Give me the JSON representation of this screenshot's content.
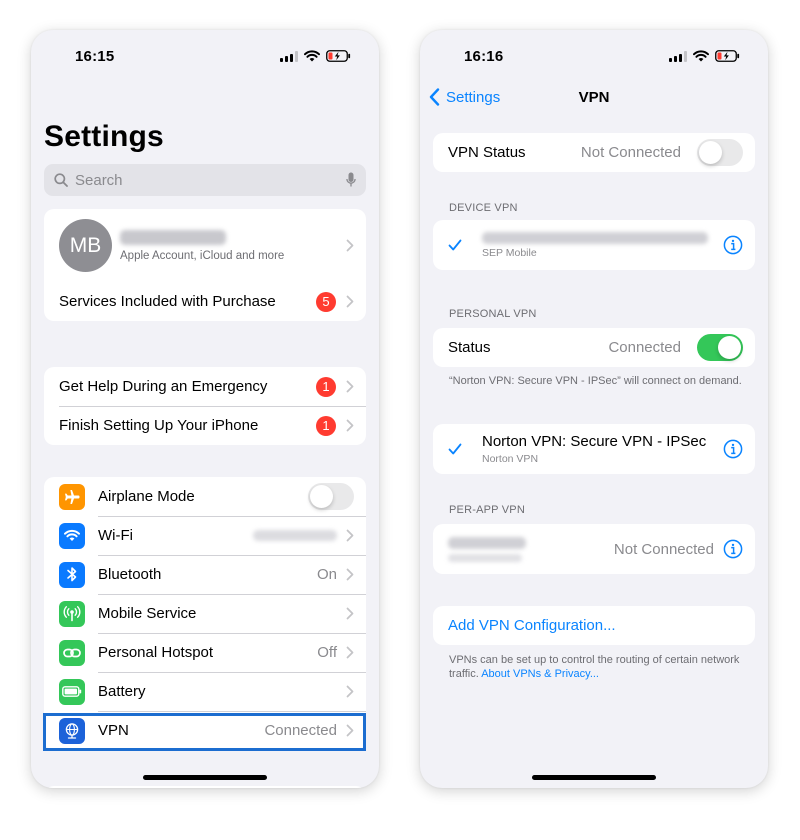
{
  "colors": {
    "accent_blue": "#0a84ff",
    "toggle_on": "#34c759",
    "badge_red": "#ff3b30",
    "highlight": "#1c6dd0",
    "background": "#f2f2f7"
  },
  "left_screen": {
    "status_time": "16:15",
    "title": "Settings",
    "search": {
      "placeholder": "Search",
      "icon": "magnifier-icon",
      "mic_icon": "microphone-icon"
    },
    "profile": {
      "initials": "MB",
      "subtitle": "Apple Account, iCloud and more"
    },
    "services": {
      "label": "Services Included with Purchase",
      "badge": "5"
    },
    "help_group": [
      {
        "label": "Get Help During an Emergency",
        "badge": "1"
      },
      {
        "label": "Finish Setting Up Your iPhone",
        "badge": "1"
      }
    ],
    "settings_group": [
      {
        "label": "Airplane Mode",
        "icon": "airplane-icon",
        "icon_bg": "#ff9500",
        "toggle": "off"
      },
      {
        "label": "Wi-Fi",
        "icon": "wifi-icon",
        "icon_bg": "#0a7aff"
      },
      {
        "label": "Bluetooth",
        "value": "On",
        "icon": "bluetooth-icon",
        "icon_bg": "#0a7aff"
      },
      {
        "label": "Mobile Service",
        "icon": "antenna-icon",
        "icon_bg": "#34c759"
      },
      {
        "label": "Personal Hotspot",
        "value": "Off",
        "icon": "hotspot-chain-icon",
        "icon_bg": "#34c759"
      },
      {
        "label": "Battery",
        "icon": "battery-icon",
        "icon_bg": "#34c759"
      },
      {
        "label": "VPN",
        "value": "Connected",
        "icon": "vpn-globe-icon",
        "icon_bg": "#1c62d9",
        "highlighted": true
      }
    ]
  },
  "right_screen": {
    "status_time": "16:16",
    "nav": {
      "back_label": "Settings",
      "title": "VPN"
    },
    "vpn_status": {
      "label": "VPN Status",
      "value": "Not Connected",
      "toggle": "off"
    },
    "device_vpn": {
      "header": "DEVICE VPN",
      "subtitle": "SEP Mobile"
    },
    "personal_vpn": {
      "header": "PERSONAL VPN",
      "status_label": "Status",
      "status_value": "Connected",
      "toggle": "on",
      "footer": "“Norton VPN: Secure VPN - IPSec” will connect on demand.",
      "config_name": "Norton VPN: Secure VPN - IPSec",
      "config_sub": "Norton VPN"
    },
    "per_app_vpn": {
      "header": "PER-APP VPN",
      "value": "Not Connected"
    },
    "add_config": "Add VPN Configuration...",
    "footer_text": "VPNs can be set up to control the routing of certain network traffic. ",
    "footer_link": "About VPNs & Privacy..."
  }
}
